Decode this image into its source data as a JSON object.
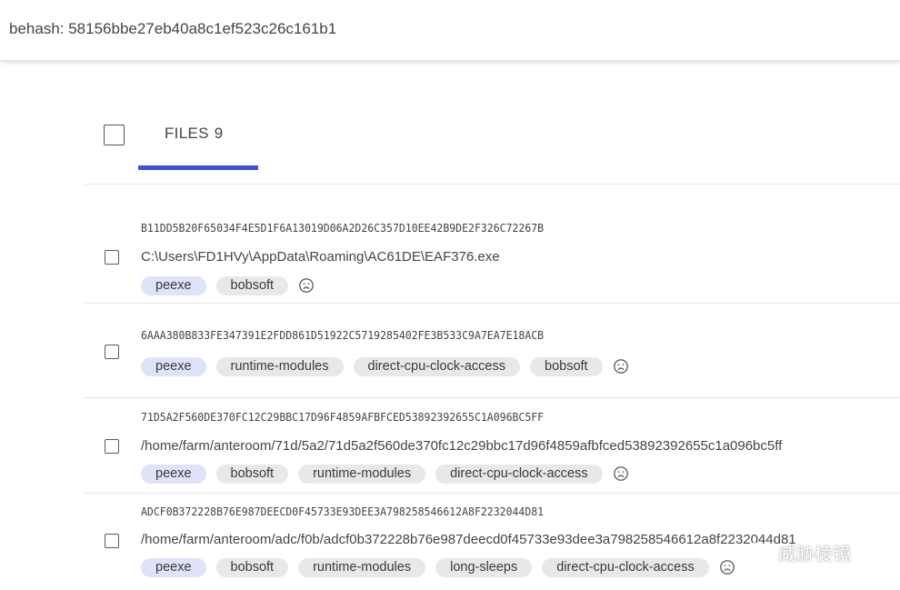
{
  "header": {
    "text": "behash: 58156bbe27eb40a8c1ef523c26c161b1"
  },
  "tab": {
    "label": "FILES",
    "count": "9"
  },
  "files": [
    {
      "hash": "B11DD5B20F65034F4E5D1F6A13019D06A2D26C357D10EE42B9DE2F326C72267B",
      "path": "C:\\Users\\FD1HVy\\AppData\\Roaming\\AC61DE\\EAF376.exe",
      "tags": [
        "peexe",
        "bobsoft"
      ]
    },
    {
      "hash": "6AAA380B833FE347391E2FDD861D51922C5719285402FE3B533C9A7EA7E18ACB",
      "path": "",
      "tags": [
        "peexe",
        "runtime-modules",
        "direct-cpu-clock-access",
        "bobsoft"
      ]
    },
    {
      "hash": "71D5A2F560DE370FC12C29BBC17D96F4859AFBFCED53892392655C1A096BC5FF",
      "path": "/home/farm/anteroom/71d/5a2/71d5a2f560de370fc12c29bbc17d96f4859afbfced53892392655c1a096bc5ff",
      "tags": [
        "peexe",
        "bobsoft",
        "runtime-modules",
        "direct-cpu-clock-access"
      ]
    },
    {
      "hash": "ADCF0B372228B76E987DEECD0F45733E93DEE3A798258546612A8F2232044D81",
      "path": "/home/farm/anteroom/adc/f0b/adcf0b372228b76e987deecd0f45733e93dee3a798258546612a8f2232044d81",
      "tags": [
        "peexe",
        "bobsoft",
        "runtime-modules",
        "long-sleeps",
        "direct-cpu-clock-access"
      ]
    }
  ],
  "watermark": {
    "text": "威胁棱镜"
  }
}
